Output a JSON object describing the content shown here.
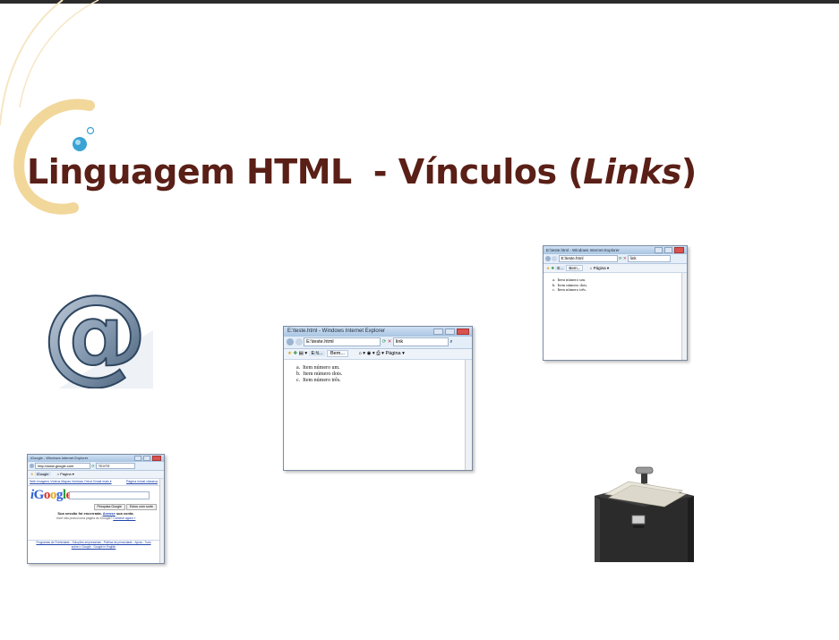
{
  "slide": {
    "title_main": "Linguagem HTML",
    "title_dash": "- Vínculos (",
    "title_italic": "Links",
    "title_close": ")"
  },
  "ie_window_large": {
    "title": "E:\\teste.html - Windows Internet Explorer",
    "address": "E:\\teste.html",
    "search": "link",
    "tab": "E:\\t...",
    "tab2": "Bem...",
    "page_menu": "Página ▾",
    "items": [
      {
        "marker": "a.",
        "text": "Item número um."
      },
      {
        "marker": "b.",
        "text": "Item número dois."
      },
      {
        "marker": "c.",
        "text": "Item número três."
      }
    ]
  },
  "ie_window_small": {
    "title": "E:\\teste.html - Windows Internet Explorer",
    "address": "E:\\teste.html",
    "search": "link",
    "tab": "E...",
    "tab2": "Bem...",
    "page_menu": "Página ▾",
    "items": [
      {
        "marker": "a.",
        "text": "Item número um."
      },
      {
        "marker": "b.",
        "text": "Item número dois."
      },
      {
        "marker": "c.",
        "text": "Item número três."
      }
    ]
  },
  "google_window": {
    "title": "iGoogle - Windows Internet Explorer",
    "address": "http://www.google.com",
    "search": "TEXTE",
    "tab": "iGoogle",
    "page_menu": "Página ▾",
    "nav_links": "Web  Imagens  Vídeos  Mapas  Notícias  Orkut  Gmail  mais ▾",
    "nav_right": "Página inicial clássica",
    "logo": "iGoogle",
    "search_button": "Pesquisa Google",
    "lucky_button": "Estou com sorte",
    "session_msg": "Sua sessão foi encerrada.",
    "session_link": "Acesse",
    "session_tail": "sua conta.",
    "question": "Você não possui uma página do iGoogle?",
    "question_link": "Comece agora »",
    "footer1": "Programas de Publicidade - Soluções empresariais - Política de privacidade - Ajuda - Tudo",
    "footer2": "sobre o Google - Google in English"
  },
  "colors": {
    "title": "#5a1f16",
    "swirl": "#f2d79a",
    "dot": "#3aa3d4"
  }
}
